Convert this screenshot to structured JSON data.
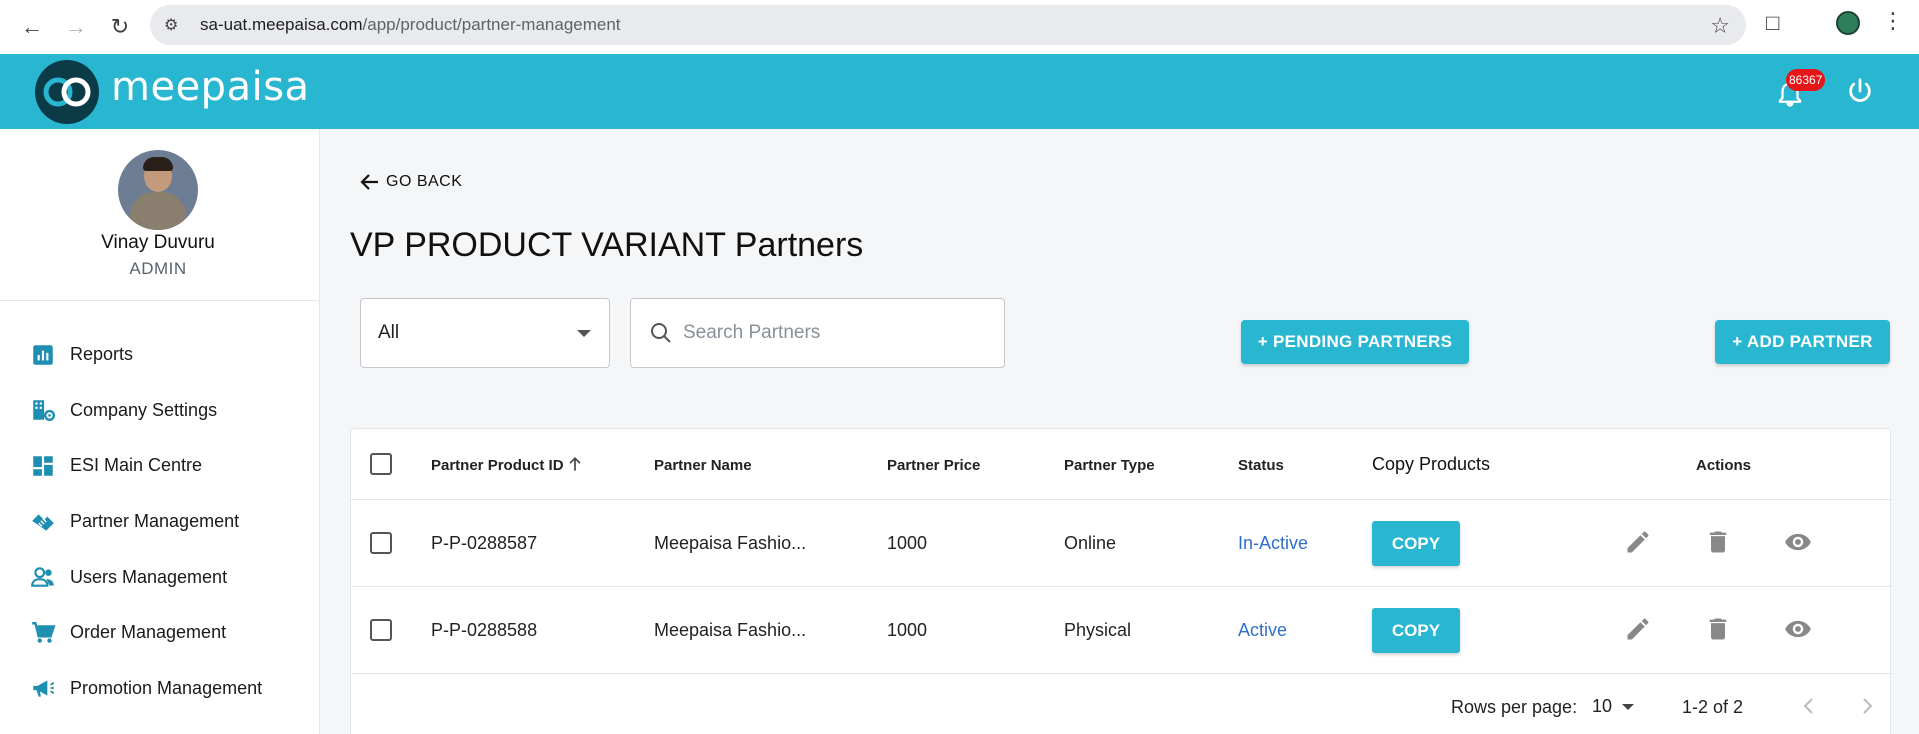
{
  "browser": {
    "url_host": "sa-uat.meepaisa.com",
    "url_path": "/app/product/partner-management"
  },
  "header": {
    "brand": "meepaisa",
    "notification_count": "86367"
  },
  "user": {
    "name": "Vinay Duvuru",
    "role": "ADMIN"
  },
  "sidebar": {
    "items": [
      {
        "label": "Reports",
        "icon": "bar-chart-icon"
      },
      {
        "label": "Company Settings",
        "icon": "company-settings-icon"
      },
      {
        "label": "ESI Main Centre",
        "icon": "dashboard-icon"
      },
      {
        "label": "Partner Management",
        "icon": "handshake-icon"
      },
      {
        "label": "Users Management",
        "icon": "users-icon"
      },
      {
        "label": "Order Management",
        "icon": "cart-icon"
      },
      {
        "label": "Promotion Management",
        "icon": "megaphone-icon"
      }
    ]
  },
  "main": {
    "go_back": "GO BACK",
    "title": "VP PRODUCT VARIANT Partners",
    "filter_value": "All",
    "search_placeholder": "Search Partners",
    "pending_button": "+ PENDING PARTNERS",
    "add_button": "+ ADD PARTNER"
  },
  "table": {
    "columns": {
      "id": "Partner Product ID",
      "name": "Partner Name",
      "price": "Partner Price",
      "type": "Partner Type",
      "status": "Status",
      "copy": "Copy Products",
      "actions": "Actions"
    },
    "rows": [
      {
        "id": "P-P-0288587",
        "name": "Meepaisa Fashio...",
        "price": "1000",
        "type": "Online",
        "status": "In-Active",
        "copy": "COPY"
      },
      {
        "id": "P-P-0288588",
        "name": "Meepaisa Fashio...",
        "price": "1000",
        "type": "Physical",
        "status": "Active",
        "copy": "COPY"
      }
    ],
    "pagination": {
      "rows_per_page_label": "Rows per page:",
      "rows_per_page": "10",
      "range": "1-2 of 2"
    }
  },
  "colors": {
    "accent": "#29b6d0",
    "status_link": "#2f6fc8",
    "badge": "#e6151a"
  }
}
